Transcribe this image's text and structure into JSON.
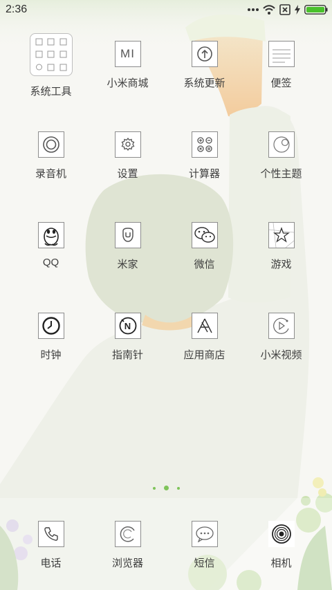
{
  "status_bar": {
    "time": "2:36",
    "icons": [
      "more-dots-icon",
      "wifi-icon",
      "sim-x-icon",
      "charging-bolt-icon",
      "battery-icon"
    ],
    "accent": "#49c12b"
  },
  "apps": [
    {
      "label": "系统工具",
      "icon": "folder-tools-icon"
    },
    {
      "label": "小米商城",
      "icon": "mi-store-icon",
      "icon_text": "MI"
    },
    {
      "label": "系统更新",
      "icon": "update-arrow-icon"
    },
    {
      "label": "便签",
      "icon": "notes-icon"
    },
    {
      "label": "录音机",
      "icon": "recorder-icon"
    },
    {
      "label": "设置",
      "icon": "gear-icon"
    },
    {
      "label": "计算器",
      "icon": "calculator-icon"
    },
    {
      "label": "个性主题",
      "icon": "theme-icon"
    },
    {
      "label": "QQ",
      "icon": "qq-penguin-icon"
    },
    {
      "label": "米家",
      "icon": "mijia-icon"
    },
    {
      "label": "微信",
      "icon": "wechat-icon"
    },
    {
      "label": "游戏",
      "icon": "star-games-icon"
    },
    {
      "label": "时钟",
      "icon": "clock-icon"
    },
    {
      "label": "指南针",
      "icon": "compass-icon",
      "icon_text": "N"
    },
    {
      "label": "应用商店",
      "icon": "app-store-icon"
    },
    {
      "label": "小米视频",
      "icon": "video-play-icon"
    }
  ],
  "page_indicator": {
    "count": 3,
    "active_index": 1,
    "color": "#7fc45a"
  },
  "dock": [
    {
      "label": "电话",
      "icon": "phone-icon"
    },
    {
      "label": "浏览器",
      "icon": "browser-icon"
    },
    {
      "label": "短信",
      "icon": "message-icon"
    },
    {
      "label": "相机",
      "icon": "camera-icon"
    }
  ]
}
